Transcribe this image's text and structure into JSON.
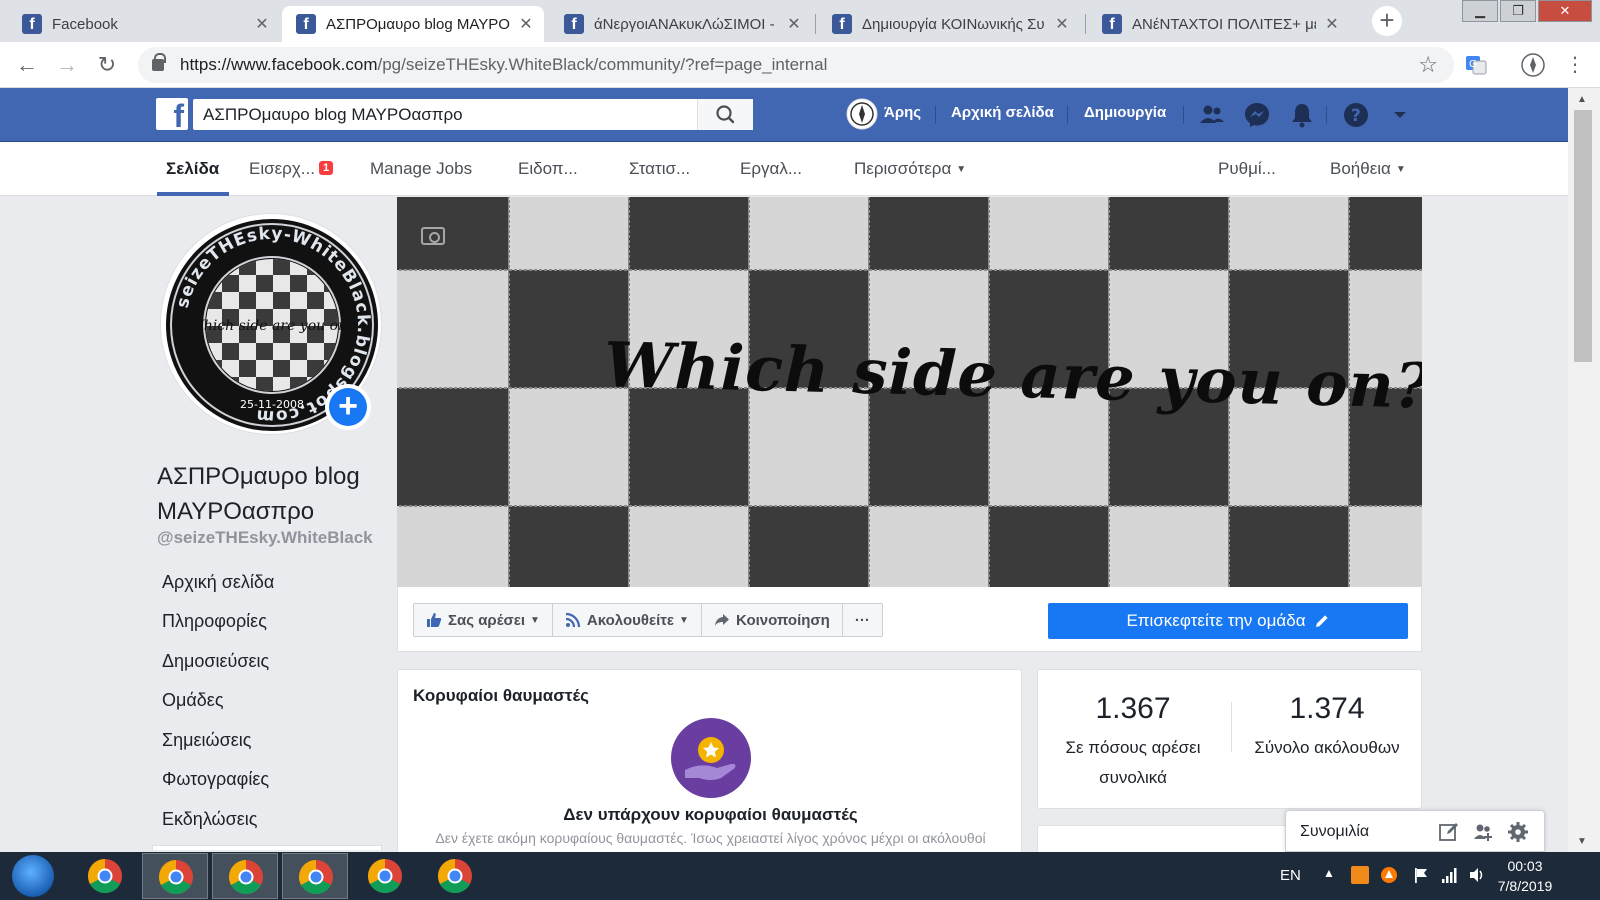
{
  "browser": {
    "tabs": [
      {
        "title": "Facebook",
        "active": false
      },
      {
        "title": "ΑΣΠΡΟμαυρο blog ΜΑΥΡΟασπρο",
        "active": true
      },
      {
        "title": "άΝεργοιΑΝΑκυκΛώΣΙΜΟΙ -",
        "active": false
      },
      {
        "title": "Δημιουργία ΚΟΙΝωνικής Συ",
        "active": false
      },
      {
        "title": "ΑΝέΝΤΑΧΤΟΙ ΠΟΛΙΤΕΣ+ με",
        "active": false
      }
    ],
    "url_host": "https://www.facebook.com",
    "url_path": "/pg/seizeTHEsky.WhiteBlack/community/?ref=page_internal"
  },
  "fb_header": {
    "search_value": "ΑΣΠΡΟμαυρο blog ΜΑΥΡΟασπρο",
    "user_name": "Άρης",
    "home_label": "Αρχική σελίδα",
    "create_label": "Δημιουργία"
  },
  "page_nav": {
    "page": "Σελίδα",
    "inbox": "Εισερχ...",
    "inbox_badge": "1",
    "jobs": "Manage Jobs",
    "notifications": "Ειδοπ...",
    "insights": "Στατισ...",
    "tools": "Εργαλ...",
    "more": "Περισσότερα",
    "settings": "Ρυθμί...",
    "help": "Βοήθεια"
  },
  "profile": {
    "name": "ΑΣΠΡΟμαυρο blog ΜΑΥΡΟασπρο",
    "handle": "@seizeTHEsky.WhiteBlack",
    "logo_ring_text": "seizeTHEsky-WhiteBlack.blogspot.com",
    "logo_inner_text": "Which side are you on?",
    "logo_date": "25-11-2008"
  },
  "left_nav": [
    "Αρχική σελίδα",
    "Πληροφορίες",
    "Δημοσιεύσεις",
    "Ομάδες",
    "Σημειώσεις",
    "Φωτογραφίες",
    "Εκδηλώσεις"
  ],
  "cover": {
    "text": "Which side are you on?"
  },
  "actions": {
    "like": "Σας αρέσει",
    "follow": "Ακολουθείτε",
    "share": "Κοινοποίηση",
    "more": "···",
    "visit_group": "Επισκεφτείτε την ομάδα"
  },
  "top_fans": {
    "title": "Κορυφαίοι θαυμαστές",
    "empty_title": "Δεν υπάρχουν κορυφαίοι θαυμαστές",
    "empty_desc": "Δεν έχετε ακόμη κορυφαίους θαυμαστές. Ίσως χρειαστεί λίγος χρόνος μέχρι οι ακόλουθοί"
  },
  "stats": {
    "likes_value": "1.367",
    "likes_label": "Σε πόσους αρέσει συνολικά",
    "followers_value": "1.374",
    "followers_label": "Σύνολο ακόλουθων"
  },
  "chat": {
    "label": "Συνομιλία"
  },
  "taskbar": {
    "lang": "EN",
    "time": "00:03",
    "date": "7/8/2019"
  },
  "colors": {
    "fb_blue": "#4267b2",
    "button_blue": "#1877f2",
    "badge_red": "#fa3e3e",
    "fans_purple": "#6a3ea1"
  }
}
